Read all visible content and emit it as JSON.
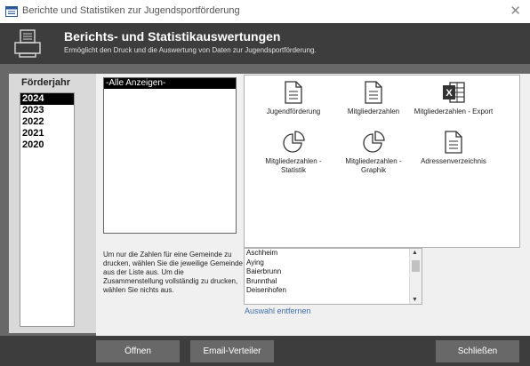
{
  "window": {
    "title": "Berichte und Statistiken zur Jugendsportförderung",
    "close_glyph": "✕"
  },
  "header": {
    "title": "Berichts- und Statistikauswertungen",
    "subtitle": "Ermöglicht den Druck und die Auswertung von Daten zur Jugendsportförderung."
  },
  "years": {
    "label": "Förderjahr",
    "items": [
      "2024",
      "2023",
      "2022",
      "2021",
      "2020"
    ],
    "selected": "2024"
  },
  "municipality_list": {
    "items": [
      "-Alle Anzeigen-"
    ],
    "selected": "-Alle Anzeigen-"
  },
  "reports": [
    {
      "label": "Jugendförderung",
      "icon": "document-icon"
    },
    {
      "label": "Mitgliederzahlen",
      "icon": "document-icon"
    },
    {
      "label": "Mitgliederzahlen - Export",
      "icon": "excel-icon"
    },
    {
      "label": "Mitgliederzahlen - Statistik",
      "icon": "pie-chart-icon"
    },
    {
      "label": "Mitgliederzahlen - Graphik",
      "icon": "pie-chart-icon"
    },
    {
      "label": "Adressenverzeichnis",
      "icon": "document-icon"
    }
  ],
  "hint": "Um nur die Zahlen für eine Gemeinde zu drucken, wählen Sie die jeweilige Gemeinde aus der Liste aus. Um die Zusammenstellung vollständig zu drucken, wählen Sie nichts aus.",
  "gemeinden": {
    "items": [
      "Aschheim",
      "Aying",
      "Baierbrunn",
      "Brunnthal",
      "Deisenhofen"
    ],
    "remove_label": "Auswahl entfernen"
  },
  "footer": {
    "open_label": "Öffnen",
    "email_label": "Email-Verteiler",
    "close_label": "Schließen"
  },
  "colors": {
    "header_bg": "#3d3d3d",
    "main_bg": "#686868",
    "button_bg": "#686868",
    "link": "#3f6fa8"
  }
}
